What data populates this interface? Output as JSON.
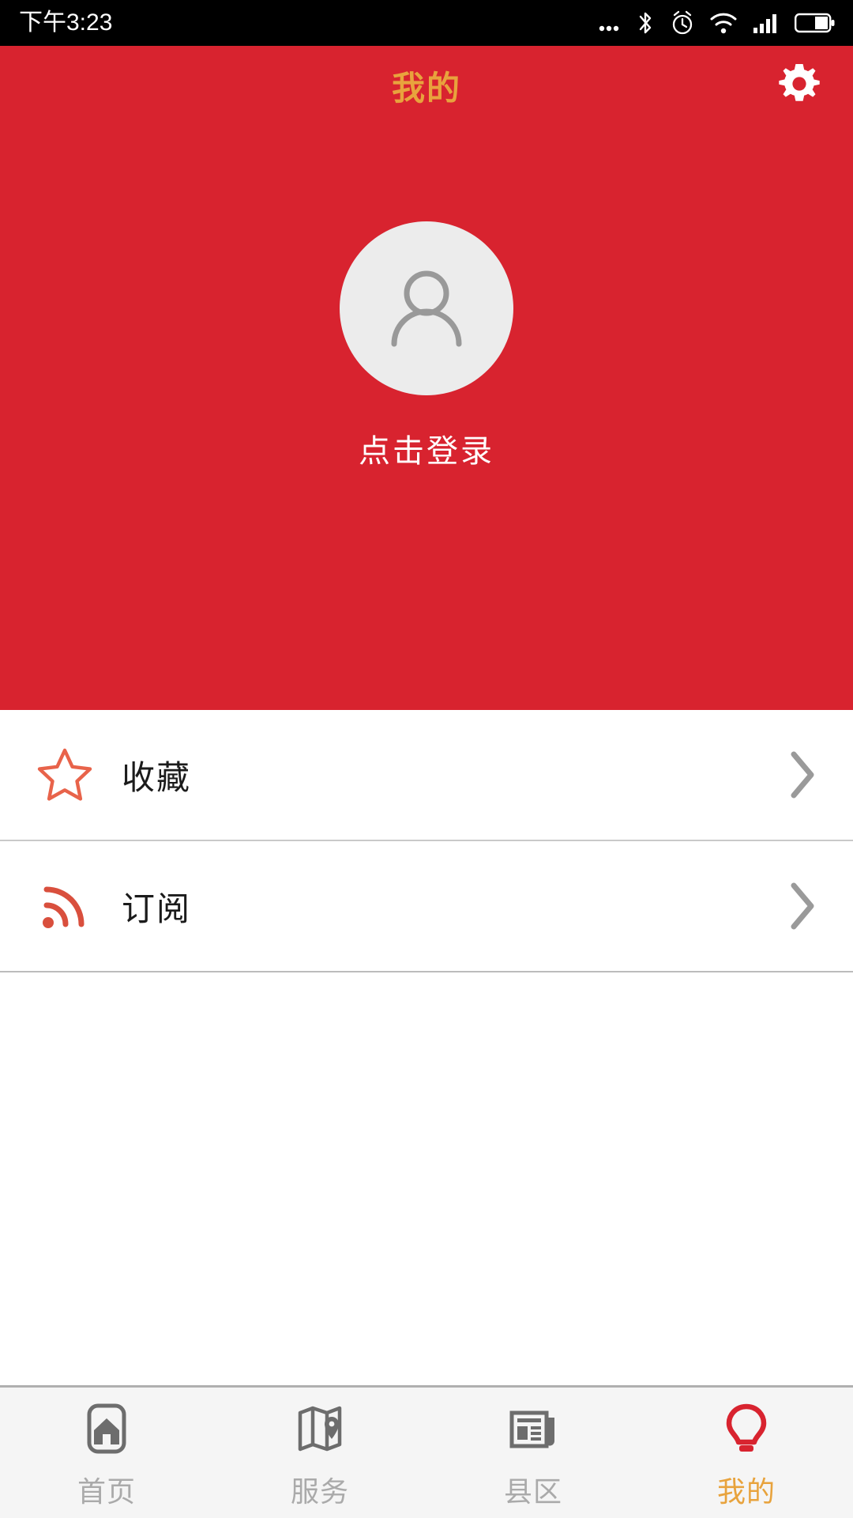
{
  "statusbar": {
    "time": "下午3:23",
    "icons": [
      "more-dots-icon",
      "bluetooth-icon",
      "alarm-clock-icon",
      "wifi-icon",
      "cellular-signal-icon",
      "battery-icon"
    ]
  },
  "header": {
    "title": "我的",
    "settings_icon": "gear-icon",
    "avatar_icon": "person-placeholder-icon",
    "login_label": "点击登录",
    "background_color": "#d8232f",
    "title_color": "#e8a33d"
  },
  "list": {
    "rows": [
      {
        "label": "收藏",
        "icon": "star-outline-icon",
        "icon_color": "#e8634a",
        "chevron": "chevron-right-icon"
      },
      {
        "label": "订阅",
        "icon": "rss-feed-icon",
        "icon_color": "#d94f3d",
        "chevron": "chevron-right-icon"
      }
    ]
  },
  "tabbar": {
    "active_index": 3,
    "active_color": "#e8a33d",
    "inactive_color": "#aaaaaa",
    "tabs": [
      {
        "label": "首页",
        "icon": "home-icon"
      },
      {
        "label": "服务",
        "icon": "map-pin-icon"
      },
      {
        "label": "县区",
        "icon": "newspaper-icon"
      },
      {
        "label": "我的",
        "icon": "lightbulb-icon"
      }
    ]
  }
}
